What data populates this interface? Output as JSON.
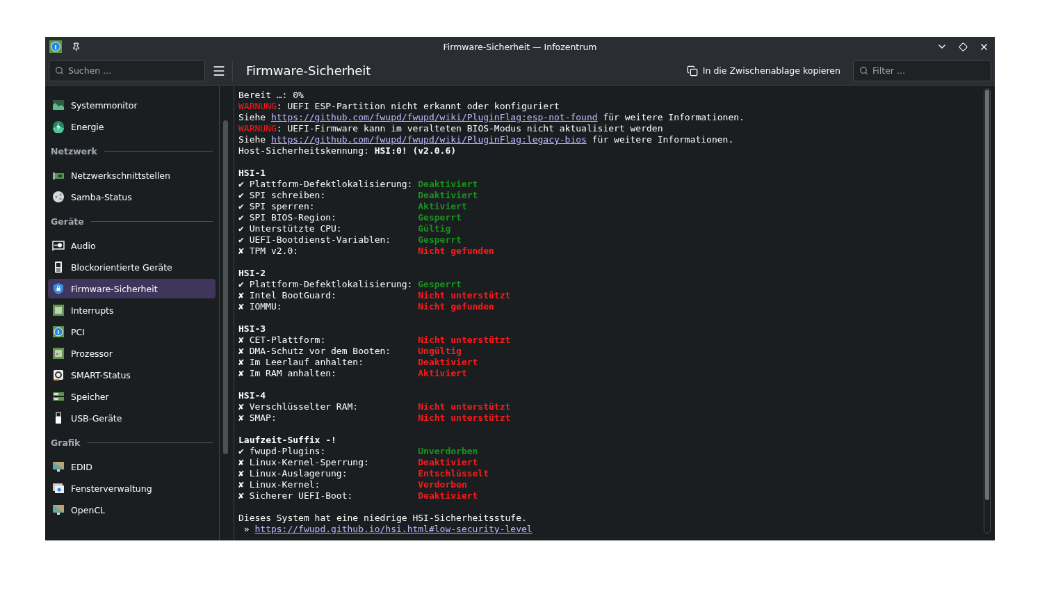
{
  "window": {
    "title": "Firmware-Sicherheit — Infozentrum"
  },
  "toolbar": {
    "search": {
      "placeholder": "Suchen ..."
    },
    "page_title": "Firmware-Sicherheit",
    "copy_button": "In die Zwischenablage kopieren",
    "filter": {
      "placeholder": "Filter ..."
    }
  },
  "sidebar": {
    "groups": [
      {
        "items": [
          {
            "label": "Systemmonitor",
            "selected": false
          },
          {
            "label": "Energie",
            "selected": false
          }
        ]
      },
      {
        "title": "Netzwerk",
        "items": [
          {
            "label": "Netzwerkschnittstellen",
            "selected": false
          },
          {
            "label": "Samba-Status",
            "selected": false
          }
        ]
      },
      {
        "title": "Geräte",
        "items": [
          {
            "label": "Audio",
            "selected": false
          },
          {
            "label": "Blockorientierte Geräte",
            "selected": false
          },
          {
            "label": "Firmware-Sicherheit",
            "selected": true
          },
          {
            "label": "Interrupts",
            "selected": false
          },
          {
            "label": "PCI",
            "selected": false
          },
          {
            "label": "Prozessor",
            "selected": false
          },
          {
            "label": "SMART-Status",
            "selected": false
          },
          {
            "label": "Speicher",
            "selected": false
          },
          {
            "label": "USB-Geräte",
            "selected": false
          }
        ]
      },
      {
        "title": "Grafik",
        "items": [
          {
            "label": "EDID",
            "selected": false
          },
          {
            "label": "Fensterverwaltung",
            "selected": false
          },
          {
            "label": "OpenCL",
            "selected": false
          }
        ]
      }
    ]
  },
  "log": [
    {
      "kind": "plain",
      "text": "Bereit …: 0%"
    },
    {
      "kind": "warning",
      "label": "WARNUNG",
      "text": ": UEFI ESP-Partition nicht erkannt oder konfiguriert"
    },
    {
      "kind": "see",
      "prefix": "Siehe",
      "link": "https://github.com/fwupd/fwupd/wiki/PluginFlag:esp-not-found",
      "suffix": "für weitere Informationen."
    },
    {
      "kind": "warning",
      "label": "WARNUNG",
      "text": ": UEFI-Firmware kann im veralteten BIOS-Modus nicht aktualisiert werden"
    },
    {
      "kind": "see",
      "prefix": "Siehe",
      "link": "https://github.com/fwupd/fwupd/wiki/PluginFlag:legacy-bios",
      "suffix": "für weitere Informationen."
    },
    {
      "kind": "plain",
      "text": "Host-Sicherheitskennung: **HSI:0! (v2.0.6)**"
    }
  ],
  "sections": [
    {
      "title": "HSI-1",
      "checks": [
        {
          "symbol": "✔",
          "label": "Plattform-Defektlokalisierung:",
          "value": "Deaktiviert",
          "passed": true
        },
        {
          "symbol": "✔",
          "label": "SPI schreiben:",
          "value": "Deaktiviert",
          "passed": true
        },
        {
          "symbol": "✔",
          "label": "SPI sperren:",
          "value": "Aktiviert",
          "passed": true
        },
        {
          "symbol": "✔",
          "label": "SPI BIOS-Region:",
          "value": "Gesperrt",
          "passed": true
        },
        {
          "symbol": "✔",
          "label": "Unterstützte CPU:",
          "value": "Gültig",
          "passed": true
        },
        {
          "symbol": "✔",
          "label": "UEFI-Bootdienst-Variablen:",
          "value": "Gesperrt",
          "passed": true
        },
        {
          "symbol": "✘",
          "label": "TPM v2.0:",
          "value": "Nicht gefunden",
          "passed": false
        }
      ]
    },
    {
      "title": "HSI-2",
      "checks": [
        {
          "symbol": "✔",
          "label": "Plattform-Defektlokalisierung:",
          "value": "Gesperrt",
          "passed": true
        },
        {
          "symbol": "✘",
          "label": "Intel BootGuard:",
          "value": "Nicht unterstützt",
          "passed": false
        },
        {
          "symbol": "✘",
          "label": "IOMMU:",
          "value": "Nicht gefunden",
          "passed": false
        }
      ]
    },
    {
      "title": "HSI-3",
      "checks": [
        {
          "symbol": "✘",
          "label": "CET-Plattform:",
          "value": "Nicht unterstützt",
          "passed": false
        },
        {
          "symbol": "✘",
          "label": "DMA-Schutz vor dem Booten:",
          "value": "Ungültig",
          "passed": false
        },
        {
          "symbol": "✘",
          "label": "Im Leerlauf anhalten:",
          "value": "Deaktiviert",
          "passed": false
        },
        {
          "symbol": "✘",
          "label": "Im RAM anhalten:",
          "value": "Aktiviert",
          "passed": false
        }
      ]
    },
    {
      "title": "HSI-4",
      "checks": [
        {
          "symbol": "✘",
          "label": "Verschlüsselter RAM:",
          "value": "Nicht unterstützt",
          "passed": false
        },
        {
          "symbol": "✘",
          "label": "SMAP:",
          "value": "Nicht unterstützt",
          "passed": false
        }
      ]
    },
    {
      "title": "Laufzeit-Suffix -!",
      "checks": [
        {
          "symbol": "✔",
          "label": "fwupd-Plugins:",
          "value": "Unverdorben",
          "passed": true
        },
        {
          "symbol": "✘",
          "label": "Linux-Kernel-Sperrung:",
          "value": "Deaktiviert",
          "passed": false
        },
        {
          "symbol": "✘",
          "label": "Linux-Auslagerung:",
          "value": "Entschlüsselt",
          "passed": false
        },
        {
          "symbol": "✘",
          "label": "Linux-Kernel:",
          "value": "Verdorben",
          "passed": false
        },
        {
          "symbol": "✘",
          "label": "Sicherer UEFI-Boot:",
          "value": "Deaktiviert",
          "passed": false
        }
      ]
    }
  ],
  "summary": {
    "text": "Dieses System hat eine niedrige HSI-Sicherheitsstufe.",
    "bullet": "»",
    "link": "https://fwupd.github.io/hsi.html#low-security-level"
  }
}
